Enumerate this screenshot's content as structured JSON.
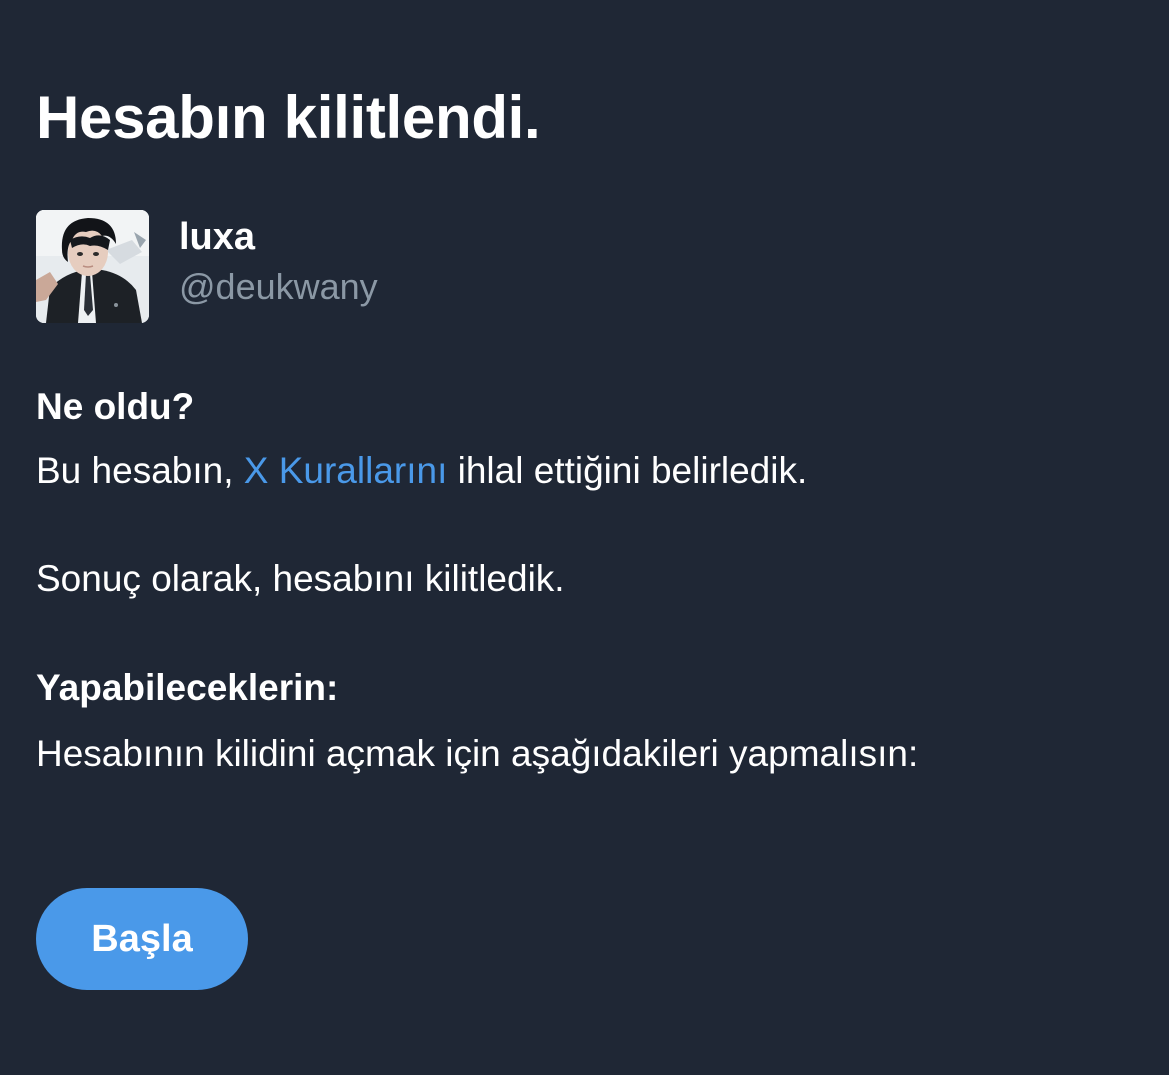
{
  "page": {
    "title": "Hesabın kilitlendi."
  },
  "account": {
    "name": "luxa",
    "handle": "@deukwany"
  },
  "what_happened": {
    "heading": "Ne oldu?",
    "sentence_prefix": "Bu hesabın, ",
    "rules_link": "X Kurallarını",
    "sentence_suffix": " ihlal ettiğini belirledik.",
    "result": "Sonuç olarak, hesabını kilitledik."
  },
  "what_you_can_do": {
    "heading": "Yapabileceklerin:",
    "instruction": "Hesabının kilidini açmak için aşağıdakileri yapmalısın:"
  },
  "actions": {
    "start_label": "Başla"
  },
  "colors": {
    "background": "#1f2735",
    "text": "#ffffff",
    "muted": "#8b98a5",
    "accent": "#4a99e9"
  },
  "icons": {
    "avatar": "profile-photo"
  }
}
